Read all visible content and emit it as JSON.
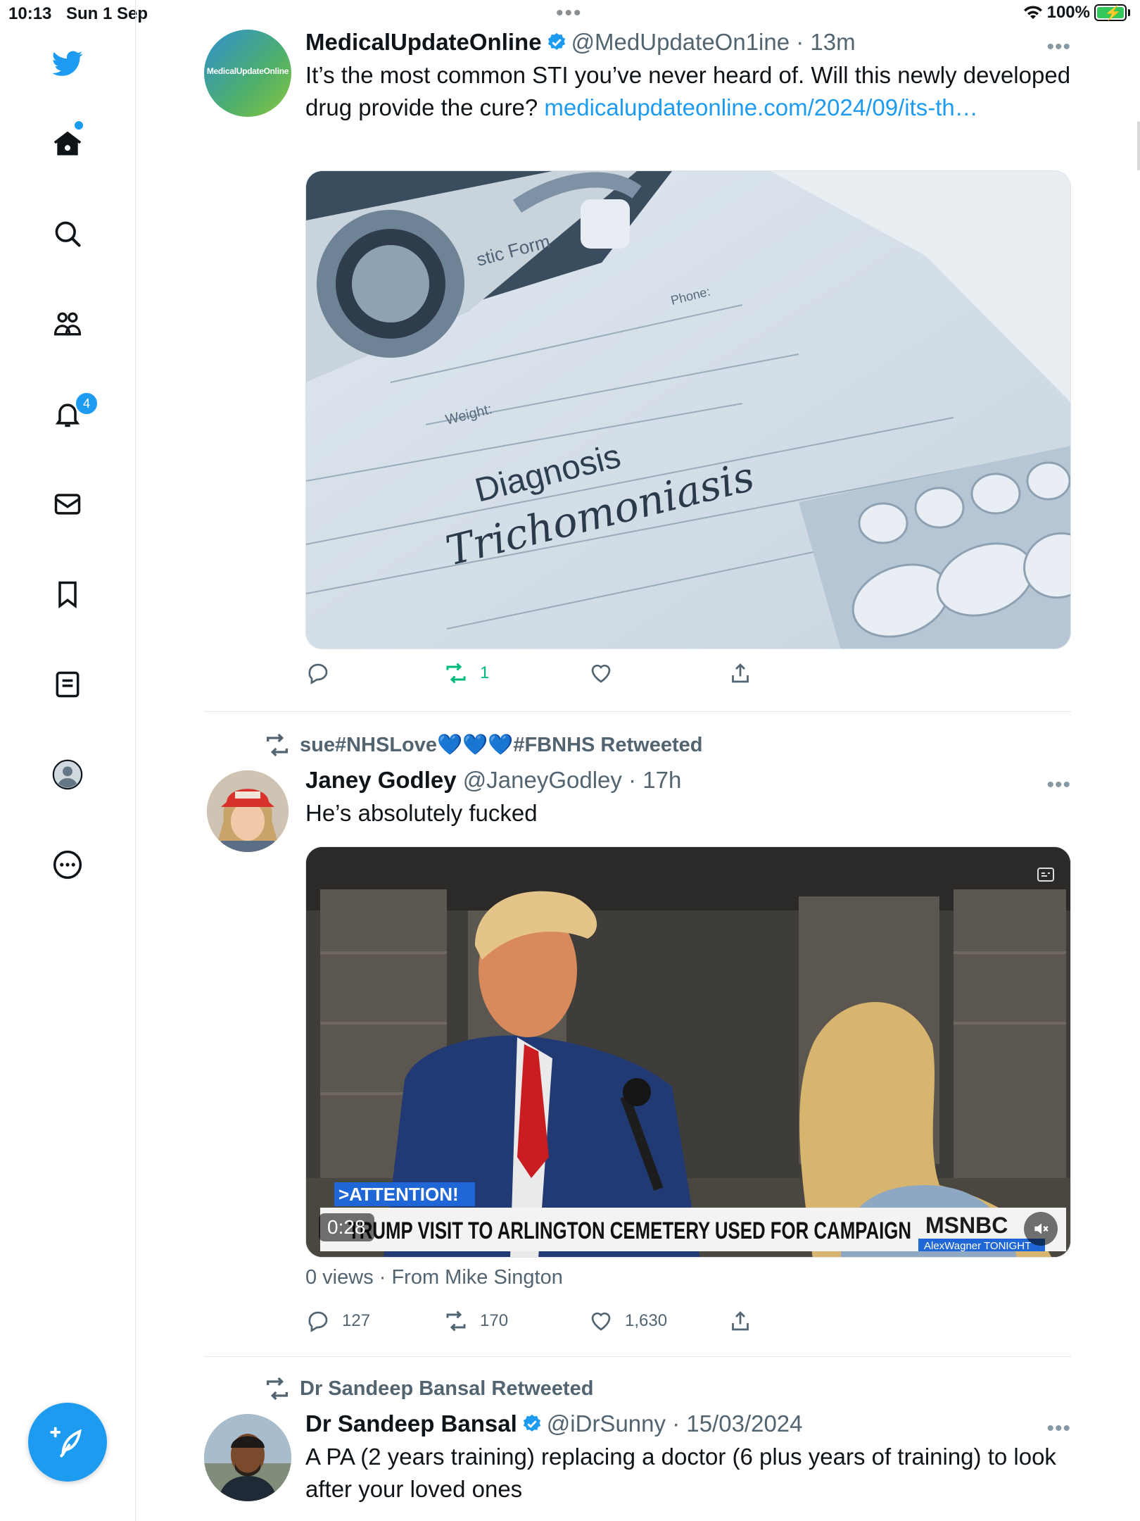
{
  "status_bar": {
    "time": "10:13",
    "date": "Sun 1 Sep",
    "battery": "100%"
  },
  "sidebar": {
    "items": [
      {
        "name": "twitter-logo"
      },
      {
        "name": "home"
      },
      {
        "name": "search"
      },
      {
        "name": "communities"
      },
      {
        "name": "notifications",
        "badge": "4"
      },
      {
        "name": "messages"
      },
      {
        "name": "bookmarks"
      },
      {
        "name": "lists"
      },
      {
        "name": "profile"
      },
      {
        "name": "more"
      }
    ],
    "compose_label": "+"
  },
  "colors": {
    "accent": "#1d9bf0",
    "retweet_active": "#00ba7c",
    "secondary_text": "#536471"
  },
  "feed": {
    "tweets": [
      {
        "display_name": "MedicalUpdateOnline",
        "handle": "@MedUpdateOn1ine",
        "time": "· 13m",
        "avatar_text": "MedicalUpdateOnline",
        "text": "It’s the most common STI you’ve never heard of. Will this newly developed drug provide the cure? ",
        "link": "medicalupdateonline.com/2024/09/its-th…",
        "image": {
          "form_label": "stic Form",
          "phone_label": "Phone:",
          "weight_label": "Weight:",
          "diagnosis": "Diagnosis",
          "condition": "Trichomoniasis"
        },
        "stats": {
          "replies": "",
          "retweets": "1",
          "likes": "",
          "share": ""
        }
      },
      {
        "retweeted_by": "sue#NHSLove💙💙💙#FBNHS Retweeted",
        "display_name": "Janey Godley",
        "handle": "@JaneyGodley",
        "time": "· 17h",
        "text": "He’s absolutely fucked",
        "video": {
          "attention": ">ATTENTION!",
          "headline": "TRUMP VISIT TO ARLINGTON CEMETERY USED FOR CAMPAIGN",
          "duration": "0:28",
          "network": "MSNBC",
          "show": "AlexWagner TONIGHT"
        },
        "subline": "0 views · From Mike Sington",
        "stats": {
          "replies": "127",
          "retweets": "170",
          "likes": "1,630",
          "share": ""
        }
      },
      {
        "retweeted_by": "Dr Sandeep Bansal Retweeted",
        "display_name": "Dr Sandeep Bansal",
        "handle": "@iDrSunny",
        "time": "· 15/03/2024",
        "text": "A PA (2 years training) replacing a doctor  (6 plus years of training) to look after your loved ones"
      }
    ]
  }
}
